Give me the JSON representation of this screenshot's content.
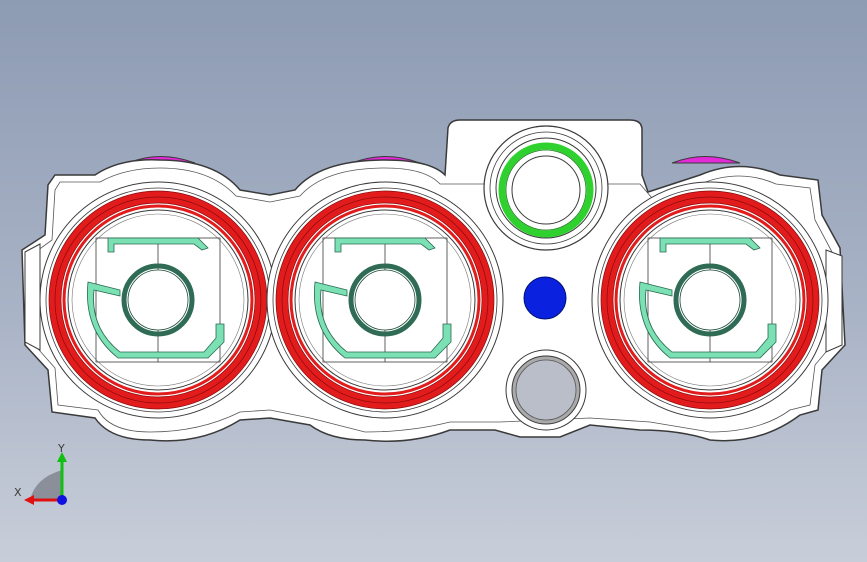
{
  "viewport": {
    "background_top": "#8d9bb3",
    "background_bottom": "#c8ced9"
  },
  "model": {
    "outline_color": "#3a3a3a",
    "body_color": "#ffffff",
    "seal_ring_color": "#e21c1c",
    "latch_color": "#7be0b4",
    "pin_color": "#2f6b55",
    "indicator_ring_color": "#2fd12f",
    "locator_dot_color": "#0a22e0",
    "tab_color": "#e22ad9",
    "cavities": 3
  },
  "triad": {
    "x_label": "X",
    "y_label": "Y",
    "x_color": "#e01010",
    "y_color": "#10c010",
    "z_color": "#1010e0"
  }
}
